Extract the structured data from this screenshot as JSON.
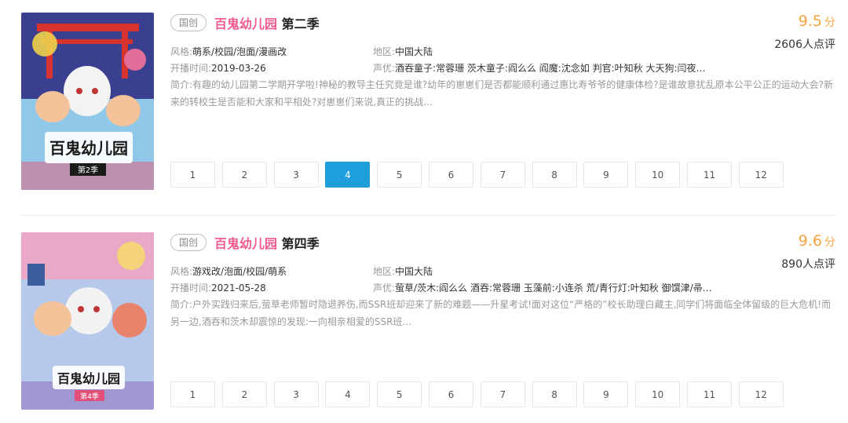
{
  "items": [
    {
      "tag": "国创",
      "title_pink": "百鬼幼儿园",
      "title_rest": "第二季",
      "score": "9.5",
      "score_unit": "分",
      "rating_count": "2606人点评",
      "style_key": "风格:",
      "style_value": "萌系/校园/泡面/漫画改",
      "date_key": "开播时间:",
      "date_value": "2019-03-26",
      "region_key": "地区:",
      "region_value": "中国大陆",
      "cast_key": "声优:",
      "cast_value": "酒吞童子:常蓉珊 茨木童子:阎么么 阎魔:沈念如 判官:叶知秋 大天狗:闫夜…",
      "desc": "简介:有趣的幼儿园第二学期开学啦!神秘的教导主任究竟是谁?幼年的崽崽们是否都能顺利通过惠比寿爷爷的健康体检?是谁故意扰乱原本公平公正的运动大会?新来的转校生是否能和大家和平相处?对崽崽们来说,真正的挑战…",
      "cover_text": "百鬼幼儿园",
      "cover_sub": "第2季",
      "episodes": [
        "1",
        "2",
        "3",
        "4",
        "5",
        "6",
        "7",
        "8",
        "9",
        "10",
        "11",
        "12"
      ],
      "active_episode": 4
    },
    {
      "tag": "国创",
      "title_pink": "百鬼幼儿园",
      "title_rest": "第四季",
      "score": "9.6",
      "score_unit": "分",
      "rating_count": "890人点评",
      "style_key": "风格:",
      "style_value": "游戏改/泡面/校园/萌系",
      "date_key": "开播时间:",
      "date_value": "2021-05-28",
      "region_key": "地区:",
      "region_value": "中国大陆",
      "cast_key": "声优:",
      "cast_value": "萤草/茨木:阎么么 酒吞:常蓉珊 玉藻前:小连杀 荒/青行灯:叶知秋 御馔津/帚…",
      "desc": "简介:户外实践归来后,萤草老师暂时隐退养伤,而SSR班却迎来了新的难题——升星考试!面对这位“严格的”校长助理白藏主,同学们将面临全体留级的巨大危机!而另一边,酒吞和茨木却震惊的发现:一向相亲相爱的SSR班…",
      "cover_text": "百鬼幼儿园",
      "cover_sub": "第4季",
      "episodes": [
        "1",
        "2",
        "3",
        "4",
        "5",
        "6",
        "7",
        "8",
        "9",
        "10",
        "11",
        "12"
      ],
      "active_episode": null
    }
  ],
  "colors": {
    "accent_pink": "#f35b8f",
    "score_orange": "#f8a33b",
    "active_blue": "#1e9edb"
  }
}
